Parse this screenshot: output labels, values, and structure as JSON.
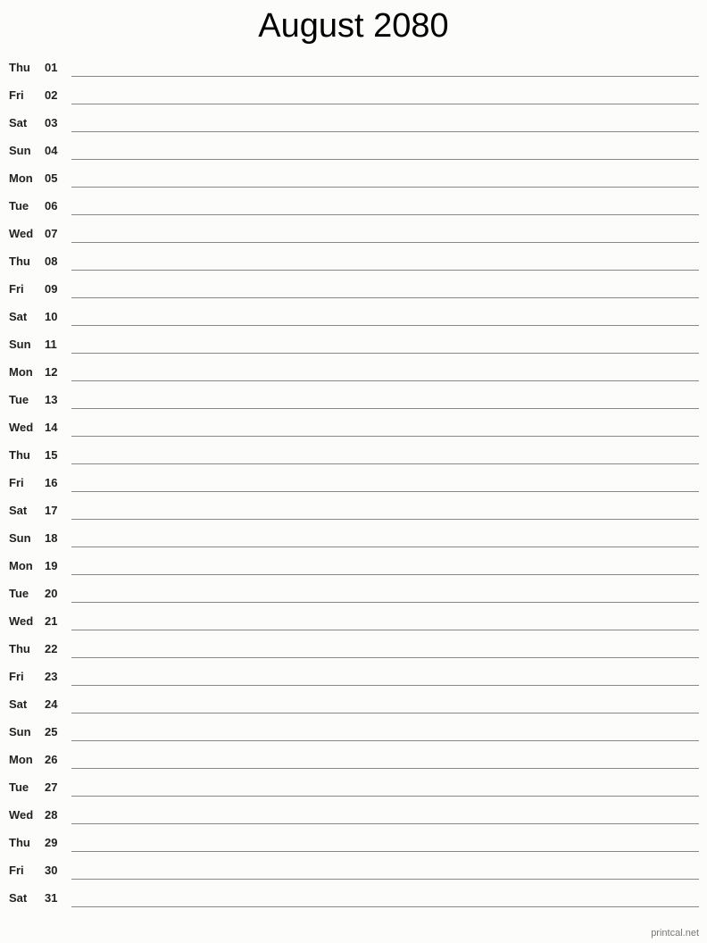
{
  "title": "August 2080",
  "days": [
    {
      "dow": "Thu",
      "day": "01"
    },
    {
      "dow": "Fri",
      "day": "02"
    },
    {
      "dow": "Sat",
      "day": "03"
    },
    {
      "dow": "Sun",
      "day": "04"
    },
    {
      "dow": "Mon",
      "day": "05"
    },
    {
      "dow": "Tue",
      "day": "06"
    },
    {
      "dow": "Wed",
      "day": "07"
    },
    {
      "dow": "Thu",
      "day": "08"
    },
    {
      "dow": "Fri",
      "day": "09"
    },
    {
      "dow": "Sat",
      "day": "10"
    },
    {
      "dow": "Sun",
      "day": "11"
    },
    {
      "dow": "Mon",
      "day": "12"
    },
    {
      "dow": "Tue",
      "day": "13"
    },
    {
      "dow": "Wed",
      "day": "14"
    },
    {
      "dow": "Thu",
      "day": "15"
    },
    {
      "dow": "Fri",
      "day": "16"
    },
    {
      "dow": "Sat",
      "day": "17"
    },
    {
      "dow": "Sun",
      "day": "18"
    },
    {
      "dow": "Mon",
      "day": "19"
    },
    {
      "dow": "Tue",
      "day": "20"
    },
    {
      "dow": "Wed",
      "day": "21"
    },
    {
      "dow": "Thu",
      "day": "22"
    },
    {
      "dow": "Fri",
      "day": "23"
    },
    {
      "dow": "Sat",
      "day": "24"
    },
    {
      "dow": "Sun",
      "day": "25"
    },
    {
      "dow": "Mon",
      "day": "26"
    },
    {
      "dow": "Tue",
      "day": "27"
    },
    {
      "dow": "Wed",
      "day": "28"
    },
    {
      "dow": "Thu",
      "day": "29"
    },
    {
      "dow": "Fri",
      "day": "30"
    },
    {
      "dow": "Sat",
      "day": "31"
    }
  ],
  "footer": "printcal.net"
}
